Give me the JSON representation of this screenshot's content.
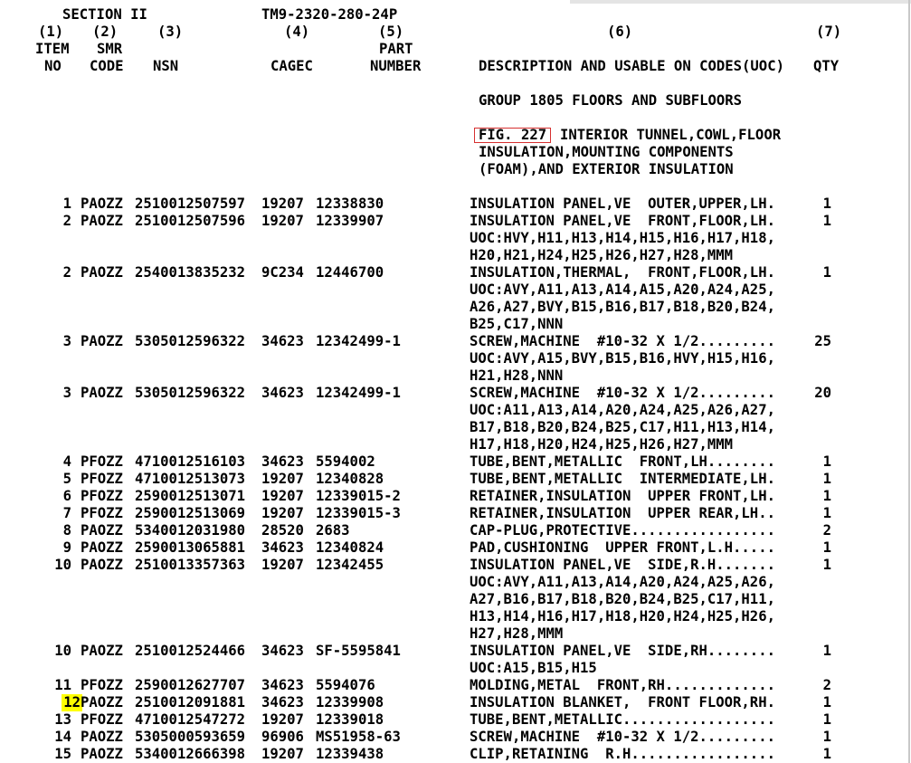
{
  "header": {
    "section": "SECTION II",
    "tm_number": "TM9-2320-280-24P",
    "col_numbers": [
      "(1)",
      "(2)",
      "(3)",
      "(4)",
      "(5)",
      "(6)",
      "(7)"
    ],
    "col_part_top": "PART",
    "col_item_top": "ITEM",
    "col_smr_top": "SMR",
    "col_item_bottom": "NO",
    "col_smr_bottom": "CODE",
    "col_nsn": "NSN",
    "col_cagec": "CAGEC",
    "col_part_bottom": "NUMBER",
    "col_description": "DESCRIPTION AND USABLE ON CODES(UOC)",
    "col_qty": "QTY"
  },
  "group_title": "GROUP 1805 FLOORS AND SUBFLOORS",
  "figure": {
    "label": "FIG. 227",
    "line1": "INTERIOR TUNNEL,COWL,FLOOR",
    "line2": "INSULATION,MOUNTING COMPONENTS",
    "line3": "(FOAM),AND EXTERIOR INSULATION"
  },
  "rows": [
    {
      "item": "1",
      "smr": "PAOZZ",
      "nsn": "2510012507597",
      "cagec": "19207",
      "part": "12338830",
      "desc": [
        "INSULATION PANEL,VE  OUTER,UPPER,LH."
      ],
      "qty": "1"
    },
    {
      "item": "2",
      "smr": "PAOZZ",
      "nsn": "2510012507596",
      "cagec": "19207",
      "part": "12339907",
      "desc": [
        "INSULATION PANEL,VE  FRONT,FLOOR,LH.",
        "UOC:HVY,H11,H13,H14,H15,H16,H17,H18,",
        "H20,H21,H24,H25,H26,H27,H28,MMM"
      ],
      "qty": "1"
    },
    {
      "item": "2",
      "smr": "PAOZZ",
      "nsn": "2540013835232",
      "cagec": "9C234",
      "part": "12446700",
      "desc": [
        "INSULATION,THERMAL,  FRONT,FLOOR,LH.",
        "UOC:AVY,A11,A13,A14,A15,A20,A24,A25,",
        "A26,A27,BVY,B15,B16,B17,B18,B20,B24,",
        "B25,C17,NNN"
      ],
      "qty": "1"
    },
    {
      "item": "3",
      "smr": "PAOZZ",
      "nsn": "5305012596322",
      "cagec": "34623",
      "part": "12342499-1",
      "desc": [
        "SCREW,MACHINE  #10-32 X 1/2.........",
        "UOC:AVY,A15,BVY,B15,B16,HVY,H15,H16,",
        "H21,H28,NNN"
      ],
      "qty": "25"
    },
    {
      "item": "3",
      "smr": "PAOZZ",
      "nsn": "5305012596322",
      "cagec": "34623",
      "part": "12342499-1",
      "desc": [
        "SCREW,MACHINE  #10-32 X 1/2.........",
        "UOC:A11,A13,A14,A20,A24,A25,A26,A27,",
        "B17,B18,B20,B24,B25,C17,H11,H13,H14,",
        "H17,H18,H20,H24,H25,H26,H27,MMM"
      ],
      "qty": "20"
    },
    {
      "item": "4",
      "smr": "PFOZZ",
      "nsn": "4710012516103",
      "cagec": "34623",
      "part": "5594002",
      "desc": [
        "TUBE,BENT,METALLIC  FRONT,LH........"
      ],
      "qty": "1"
    },
    {
      "item": "5",
      "smr": "PFOZZ",
      "nsn": "4710012513073",
      "cagec": "19207",
      "part": "12340828",
      "desc": [
        "TUBE,BENT,METALLIC  INTERMEDIATE,LH."
      ],
      "qty": "1"
    },
    {
      "item": "6",
      "smr": "PFOZZ",
      "nsn": "2590012513071",
      "cagec": "19207",
      "part": "12339015-2",
      "desc": [
        "RETAINER,INSULATION  UPPER FRONT,LH."
      ],
      "qty": "1"
    },
    {
      "item": "7",
      "smr": "PFOZZ",
      "nsn": "2590012513069",
      "cagec": "19207",
      "part": "12339015-3",
      "desc": [
        "RETAINER,INSULATION  UPPER REAR,LH.."
      ],
      "qty": "1"
    },
    {
      "item": "8",
      "smr": "PAOZZ",
      "nsn": "5340012031980",
      "cagec": "28520",
      "part": "2683",
      "desc": [
        "CAP-PLUG,PROTECTIVE................."
      ],
      "qty": "2"
    },
    {
      "item": "9",
      "smr": "PAOZZ",
      "nsn": "2590013065881",
      "cagec": "34623",
      "part": "12340824",
      "desc": [
        "PAD,CUSHIONING  UPPER FRONT,L.H....."
      ],
      "qty": "1"
    },
    {
      "item": "10",
      "smr": "PAOZZ",
      "nsn": "2510013357363",
      "cagec": "19207",
      "part": "12342455",
      "desc": [
        "INSULATION PANEL,VE  SIDE,R.H.......",
        "UOC:AVY,A11,A13,A14,A20,A24,A25,A26,",
        "A27,B16,B17,B18,B20,B24,B25,C17,H11,",
        "H13,H14,H16,H17,H18,H20,H24,H25,H26,",
        "H27,H28,MMM"
      ],
      "qty": "1"
    },
    {
      "item": "10",
      "smr": "PAOZZ",
      "nsn": "2510012524466",
      "cagec": "34623",
      "part": "SF-5595841",
      "desc": [
        "INSULATION PANEL,VE  SIDE,RH........",
        "UOC:A15,B15,H15"
      ],
      "qty": "1"
    },
    {
      "item": "11",
      "smr": "PFOZZ",
      "nsn": "2590012627707",
      "cagec": "34623",
      "part": "5594076",
      "desc": [
        "MOLDING,METAL  FRONT,RH............."
      ],
      "qty": "2"
    },
    {
      "item": "12",
      "smr": "PAOZZ",
      "nsn": "2510012091881",
      "cagec": "34623",
      "part": "12339908",
      "desc": [
        "INSULATION BLANKET,  FRONT FLOOR,RH."
      ],
      "qty": "1",
      "highlight": true
    },
    {
      "item": "13",
      "smr": "PFOZZ",
      "nsn": "4710012547272",
      "cagec": "19207",
      "part": "12339018",
      "desc": [
        "TUBE,BENT,METALLIC.................."
      ],
      "qty": "1"
    },
    {
      "item": "14",
      "smr": "PAOZZ",
      "nsn": "5305000593659",
      "cagec": "96906",
      "part": "MS51958-63",
      "desc": [
        "SCREW,MACHINE  #10-32 X 1/2........."
      ],
      "qty": "1"
    },
    {
      "item": "15",
      "smr": "PAOZZ",
      "nsn": "5340012666398",
      "cagec": "19207",
      "part": "12339438",
      "desc": [
        "CLIP,RETAINING  R.H................."
      ],
      "qty": "1"
    }
  ],
  "colors": {
    "highlight": "#ffff00",
    "fig_box": "#d63030"
  }
}
